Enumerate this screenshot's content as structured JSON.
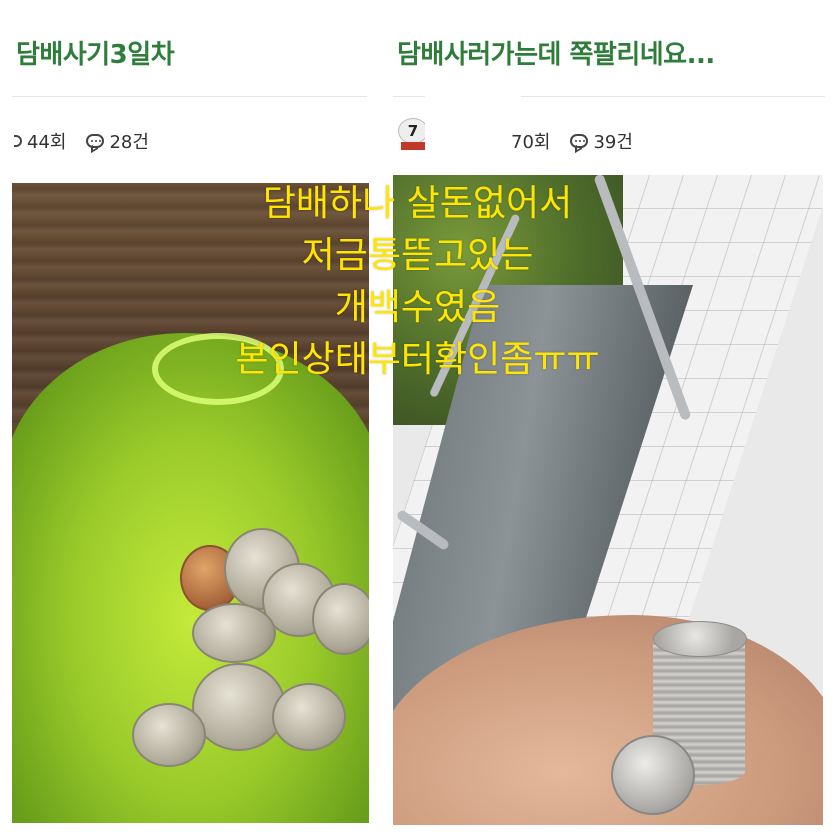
{
  "left_post": {
    "title": "담배사기3일차",
    "views": "44회",
    "comments": "28건"
  },
  "right_post": {
    "title": "담배사러가는데 쪽팔리네요...",
    "author_level": "7",
    "views": "70회",
    "comments": "39건"
  },
  "overlay_caption": {
    "line1": "담배하나 살돈없어서",
    "line2": "저금통뜯고있는",
    "line3": "개백수였음",
    "line4": "본인상태부터확인좀ㅠㅠ"
  },
  "colors": {
    "title_green": "#2f7d3a",
    "caption_yellow": "#ffe600"
  },
  "icons": {
    "comment": "comment-bubble-icon",
    "views": "eye-icon",
    "level_badge": "level-badge-icon"
  }
}
